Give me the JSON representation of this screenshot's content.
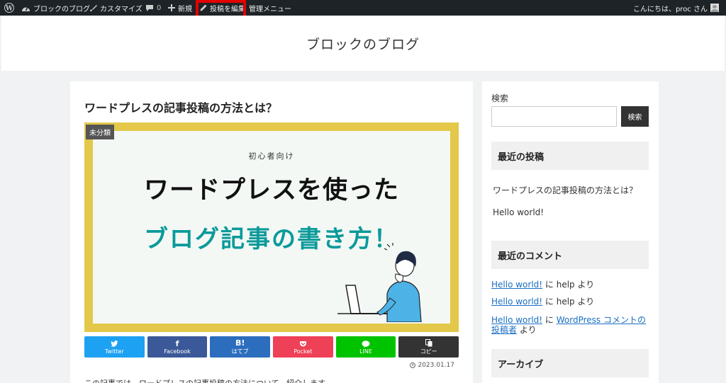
{
  "admin_bar": {
    "site_name": "ブロックのブログ",
    "customize": "カスタマイズ",
    "comments_count": "0",
    "new_label": "新規",
    "edit_post": "投稿を編集",
    "manage_menu": "管理メニュー",
    "howdy": "こんにちは、proc さん",
    "icons": [
      "wordpress-icon",
      "dashboard-icon",
      "brush-icon",
      "comment-bubble-icon",
      "plus-icon",
      "pencil-icon",
      "avatar"
    ],
    "highlight_color": "#e30000"
  },
  "site": {
    "title": "ブロックのブログ"
  },
  "post": {
    "title": "ワードプレスの記事投稿の方法とは？",
    "category": "未分類",
    "eyecatch": {
      "subtitle": "初心者向け",
      "headline": "ワードプレスを使った",
      "headline2": "ブログ記事の書き方！",
      "frame_color": "#e3c84a",
      "accent_color": "#0b9a9a"
    },
    "date": "2023.01.17",
    "excerpt": "この記事では、ワードプレスの記事投稿の方法について、紹介します。"
  },
  "share": [
    {
      "glyph": "🐦",
      "label": "Twitter",
      "color": "#1da1f2"
    },
    {
      "glyph": "f",
      "label": "Facebook",
      "color": "#3b5998"
    },
    {
      "glyph": "B!",
      "label": "はてブ",
      "color": "#2c6ebd"
    },
    {
      "glyph": "⌄",
      "label": "Pocket",
      "color": "#ee4056"
    },
    {
      "glyph": "●",
      "label": "LINE",
      "color": "#00c300"
    },
    {
      "glyph": "⎘",
      "label": "コピー",
      "color": "#333333"
    }
  ],
  "sidebar": {
    "search_label": "検索",
    "search_placeholder": "",
    "search_button": "検索",
    "recent_posts_title": "最近の投稿",
    "recent_posts": [
      "ワードプレスの記事投稿の方法とは？",
      "Hello world!"
    ],
    "recent_comments_title": "最近のコメント",
    "comments": [
      {
        "post": "Hello world!",
        "connector": " に ",
        "author": "help",
        "suffix": " より"
      },
      {
        "post": "Hello world!",
        "connector": " に ",
        "author": "help",
        "suffix": " より"
      },
      {
        "post": "Hello world!",
        "connector": " に ",
        "author": "WordPress コメントの投稿者",
        "suffix": " より"
      }
    ],
    "archive_title": "アーカイブ"
  }
}
